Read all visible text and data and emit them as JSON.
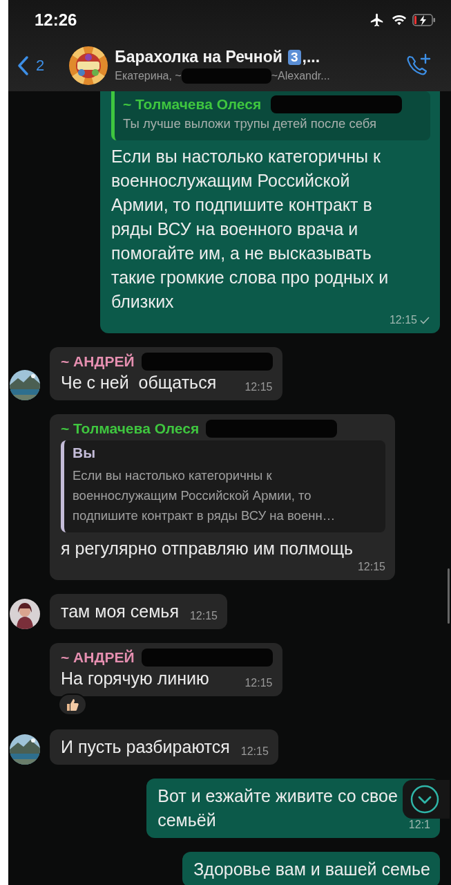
{
  "status_bar": {
    "time": "12:26"
  },
  "header": {
    "back_count": "2",
    "title": "Барахолка на Речной",
    "title_badge": "3",
    "title_tail": ",...",
    "subtitle_start": "Екатерина, ~",
    "subtitle_redacted": true,
    "subtitle_end": "~Alexandr..."
  },
  "messages": [
    {
      "kind": "out",
      "quote": {
        "sender": "~ Толмачева Олеся",
        "color": "#3fc63f",
        "redacted": true,
        "lines": [
          "Ты лучше выложи трупы детей после себя"
        ]
      },
      "lines": [
        "Если вы настолько категоричны к",
        "военнослужащим Российской",
        "Армии, то подпишите контракт в",
        "ряды ВСУ на военного врача и",
        "помогайте им, а не высказывать",
        "такие громкие слова про родных и",
        "близких"
      ],
      "time": "12:15",
      "sent": true
    },
    {
      "kind": "in",
      "avatar": {
        "kind": "landscape"
      },
      "sender": "~ АНДРЕЙ",
      "color": "#e58fb0",
      "redacted": true,
      "lines": [
        "Че с ней  общаться"
      ],
      "time": "12:15"
    },
    {
      "kind": "in",
      "sender": "~ Толмачева Олеся",
      "color": "#3fc63f",
      "redacted": true,
      "quote": {
        "sender": "Вы",
        "color": "#c4bcd8",
        "lines": [
          "Если вы настолько категоричны к",
          "военнослужащим Российской Армии, то",
          "подпишите контракт в ряды ВСУ на военн…"
        ]
      },
      "lines": [
        "я регулярно отправляю им полмощь"
      ],
      "time": "12:15"
    },
    {
      "kind": "in",
      "avatar": {
        "kind": "person"
      },
      "lines": [
        "там моя семья"
      ],
      "time": "12:15"
    },
    {
      "kind": "in",
      "sender": "~ АНДРЕЙ",
      "color": "#e58fb0",
      "redacted": true,
      "lines": [
        "На горячую линию"
      ],
      "time": "12:15",
      "reaction": {
        "kind": "thumbs-up"
      }
    },
    {
      "kind": "in",
      "avatar": {
        "kind": "landscape"
      },
      "lines": [
        "И пусть разбираются"
      ],
      "time": "12:15"
    },
    {
      "kind": "out",
      "lines": [
        "Вот и езжайте живите со свое",
        "семьёй"
      ],
      "time": "12:1",
      "scroll_button": true
    },
    {
      "kind": "out",
      "lines": [
        "Здоровье вам и вашей семье"
      ]
    }
  ]
}
